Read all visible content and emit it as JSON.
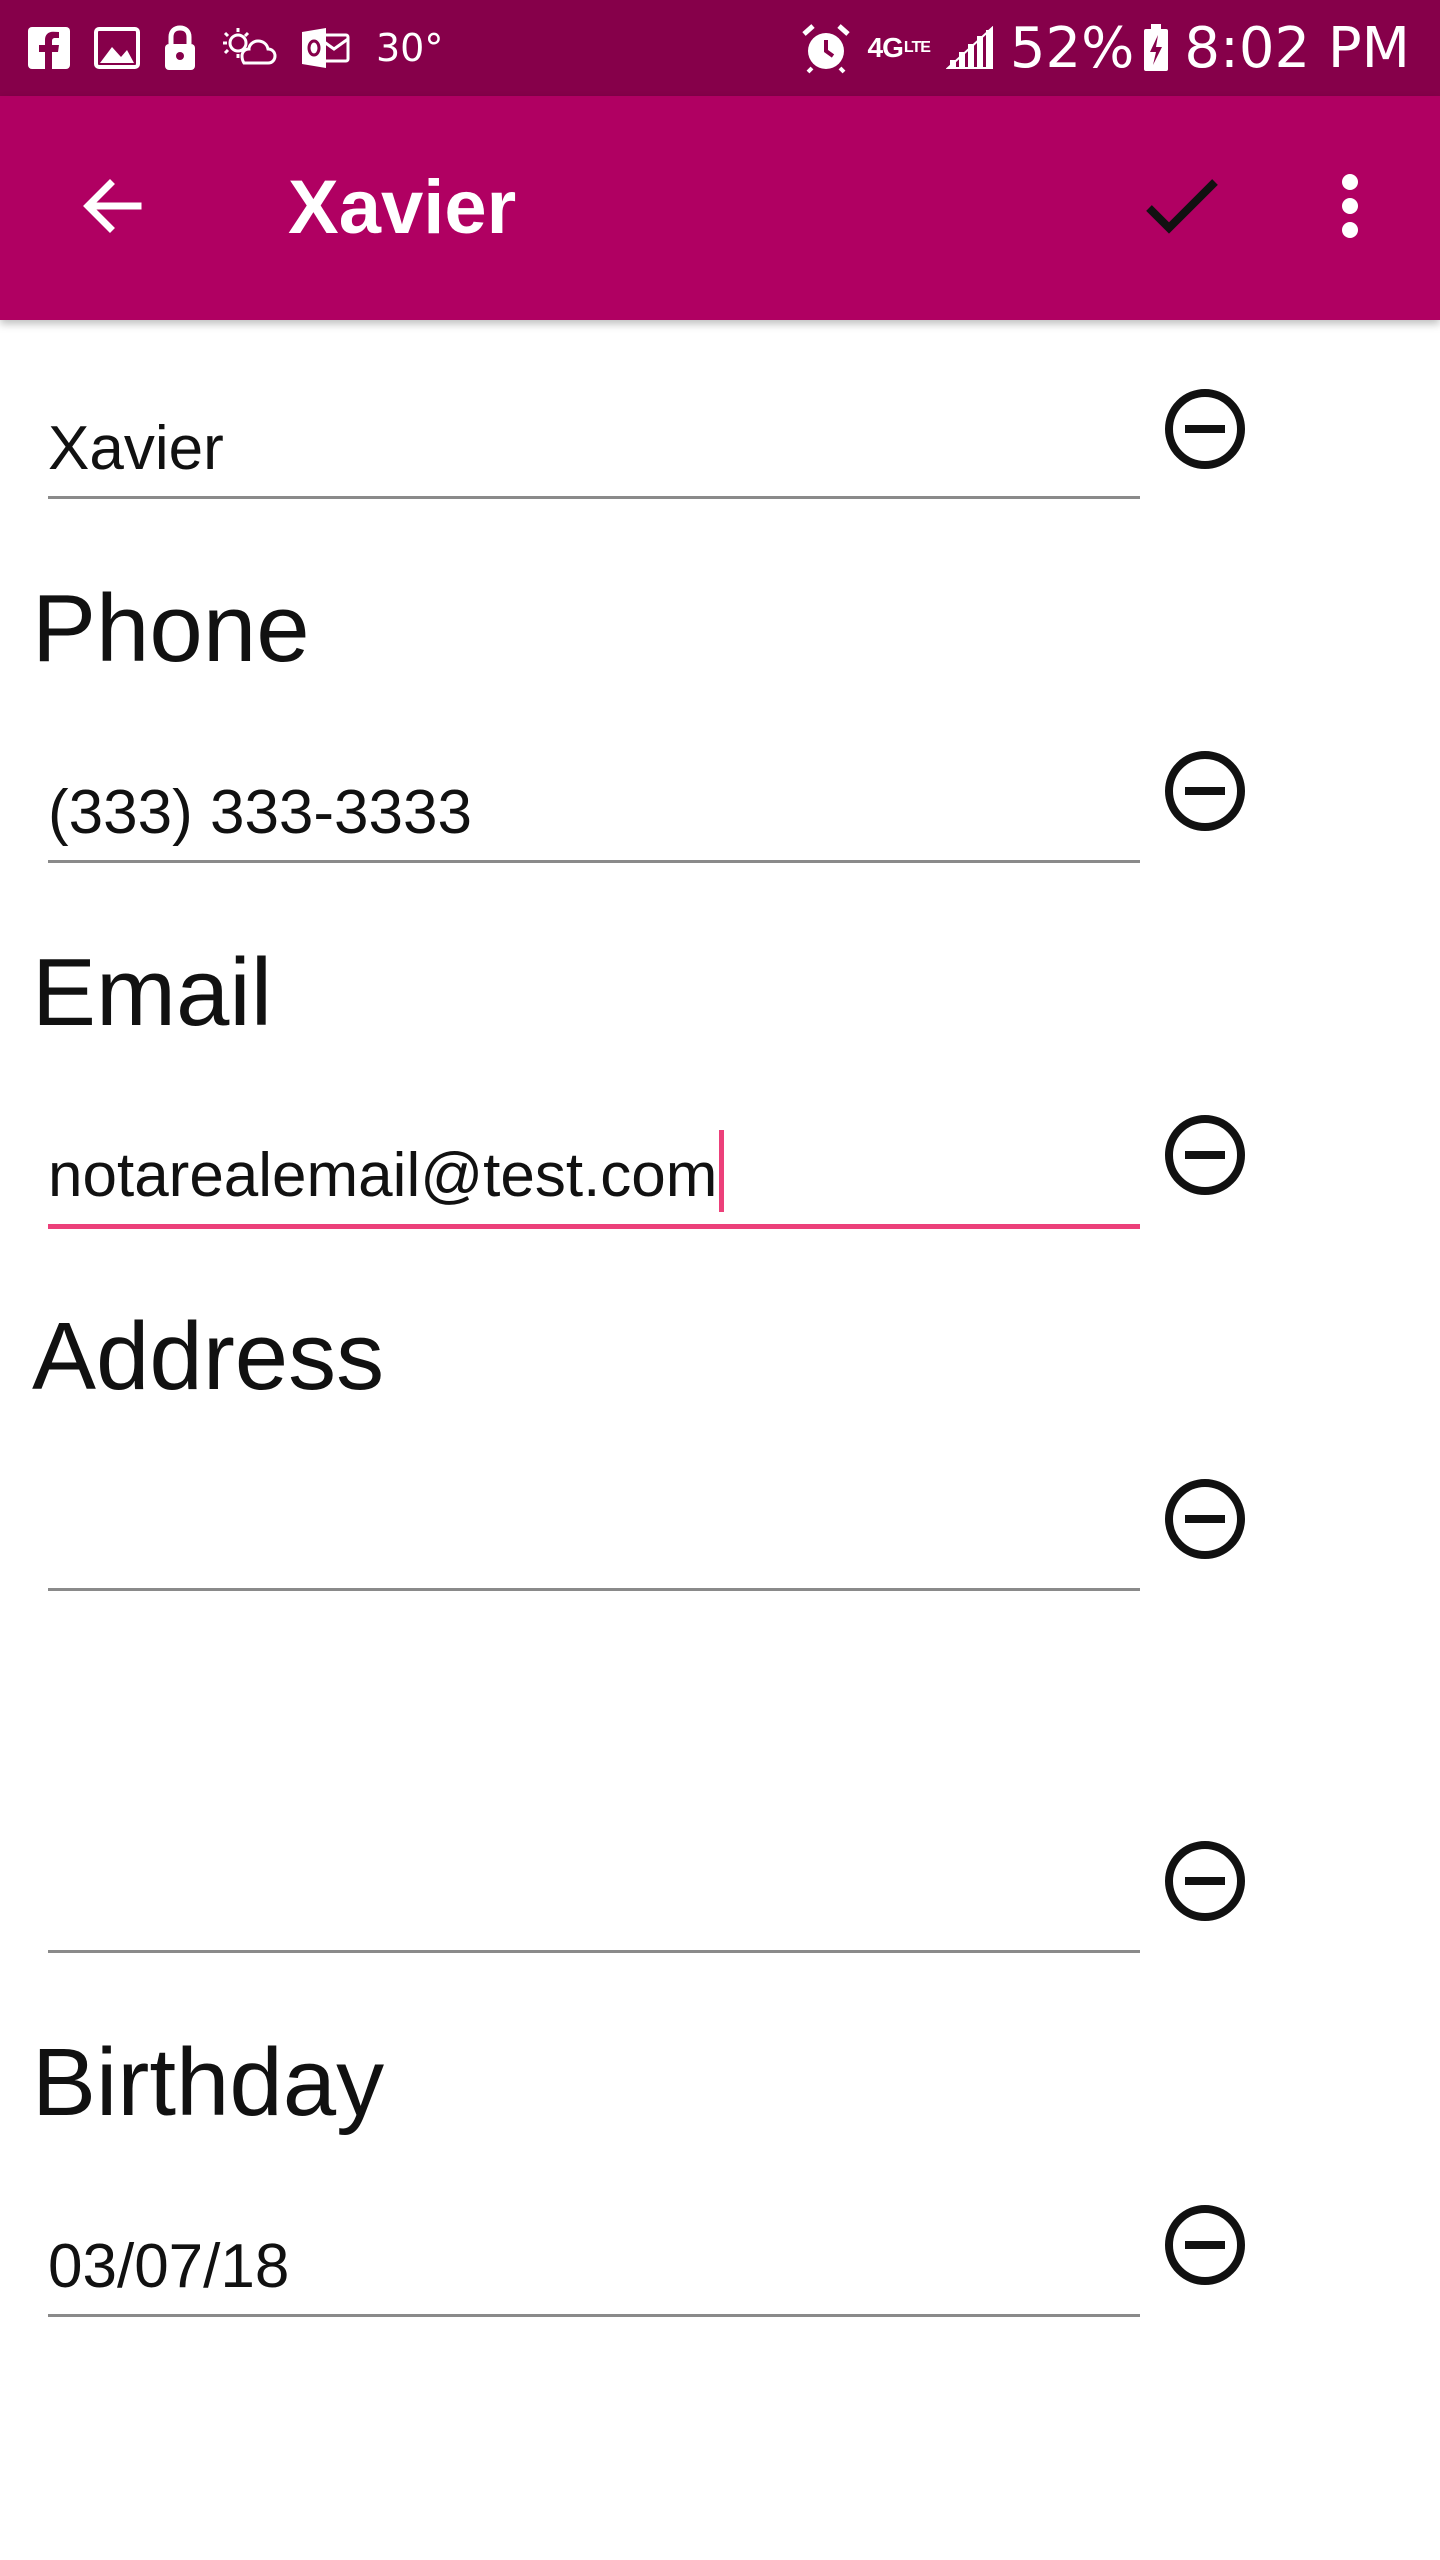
{
  "status_bar": {
    "icons_left": [
      "facebook-icon",
      "gallery-icon",
      "lock-icon",
      "weather-icon",
      "outlook-icon"
    ],
    "temperature": "30°",
    "icons_right": [
      "alarm-icon",
      "lte-icon",
      "signal-icon",
      "battery-icon"
    ],
    "lte_label": "4G",
    "battery_percent": "52%",
    "time": "8:02 PM"
  },
  "app_bar": {
    "title": "Xavier",
    "back_icon": "arrow-back-icon",
    "save_icon": "check-icon",
    "more_icon": "more-vert-icon",
    "color": "#b00062"
  },
  "form": {
    "name_value": "Xavier",
    "phone": {
      "header": "Phone",
      "value": "(333) 333-3333"
    },
    "email": {
      "header": "Email",
      "value": "notarealemail@test.com"
    },
    "address": {
      "header": "Address",
      "line1": "",
      "line2": ""
    },
    "birthday": {
      "header": "Birthday",
      "value": "03/07/18"
    },
    "remove_icon": "remove-circle-icon",
    "accent_color": "#ec407a"
  }
}
